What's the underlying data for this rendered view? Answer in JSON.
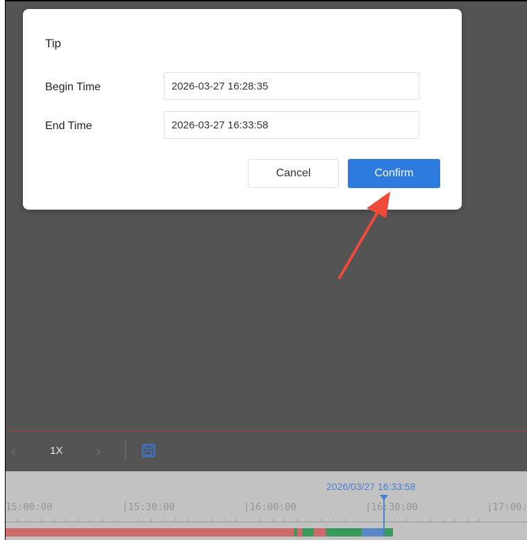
{
  "dialog": {
    "title": "Tip",
    "begin_label": "Begin Time",
    "begin_value": "2026-03-27 16:28:35",
    "end_label": "End Time",
    "end_value": "2026-03-27 16:33:58",
    "cancel_label": "Cancel",
    "confirm_label": "Confirm"
  },
  "controls": {
    "prev_icon": "chevron-left-icon",
    "speed": "1X",
    "next_icon": "chevron-right-icon",
    "save_icon": "save-icon"
  },
  "timeline": {
    "current_time": "2026/03/27 16:33:58",
    "ticks": [
      "15:00:00",
      "|15:30:00",
      "|16:00:00",
      "|16:30:00",
      "|17:00:"
    ]
  },
  "colors": {
    "accent": "#2e7be0",
    "annotation_arrow": "#f04a3a",
    "segment_red": "#cd6b6b",
    "segment_green": "#3a9a5e",
    "segment_blue": "#5b86c8"
  }
}
